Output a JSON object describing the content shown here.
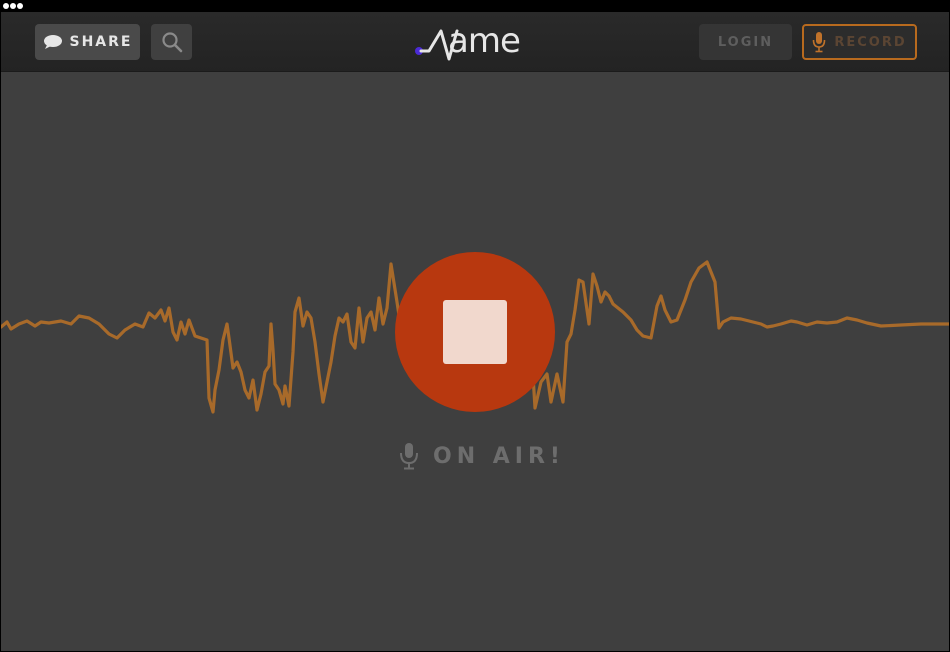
{
  "header": {
    "share_label": "SHARE",
    "login_label": "LOGIN",
    "record_label": "RECORD",
    "logo_text": "ame",
    "share_icon": "speech-bubble-icon",
    "search_icon": "search-icon",
    "record_icon": "microphone-icon"
  },
  "recorder": {
    "status_label": "ON AIR!",
    "status_icon": "microphone-icon",
    "stop_icon": "stop-icon"
  },
  "colors": {
    "waveform": "#a86a2a",
    "stop_button": "#b8380f",
    "accent_border": "#b86a1e",
    "logo_dot": "#4b2bd6"
  }
}
